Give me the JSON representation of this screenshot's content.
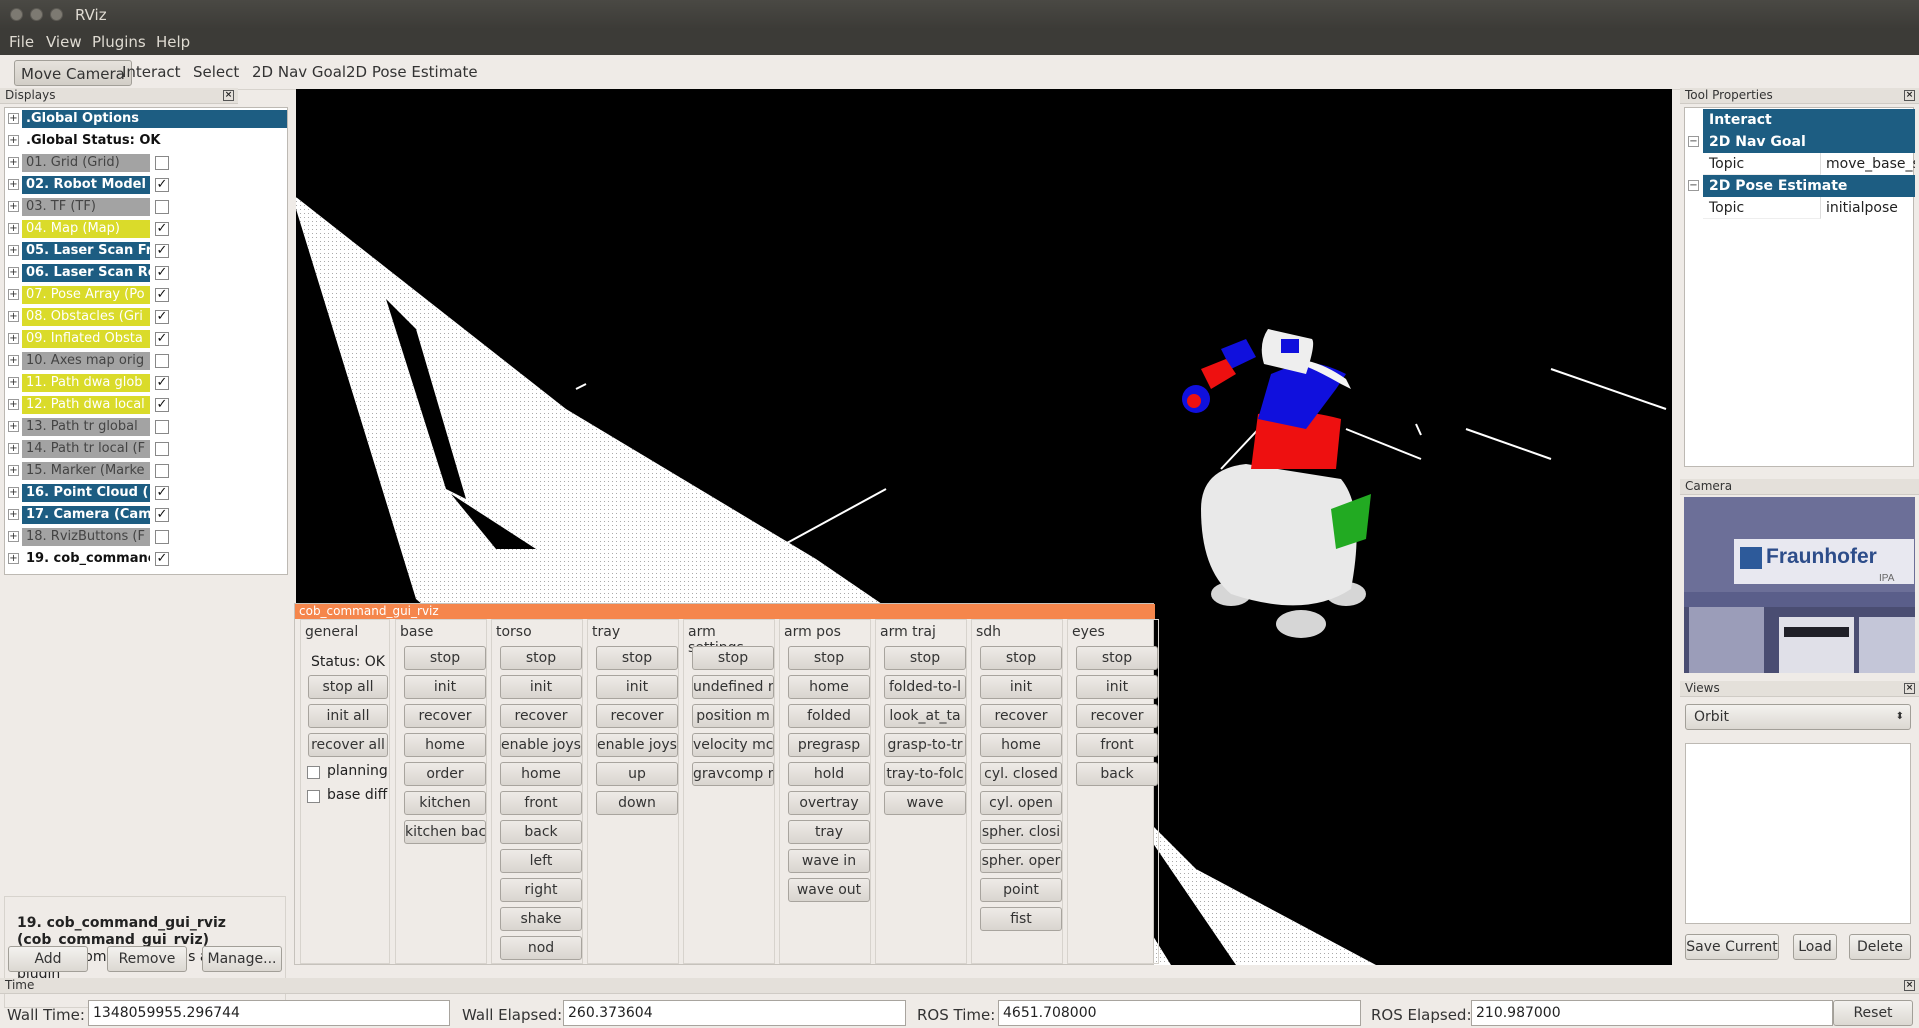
{
  "window": {
    "title": "RViz"
  },
  "menu": [
    "File",
    "View",
    "Plugins",
    "Help"
  ],
  "toolbar": {
    "tools": [
      "Move Camera",
      "Interact",
      "Select",
      "2D Nav Goal",
      "2D Pose Estimate"
    ],
    "active": "Move Camera"
  },
  "displays": {
    "header": "Displays",
    "items": [
      {
        "label": ".Global Options",
        "style": "blue",
        "checked": null
      },
      {
        "label": ".Global Status: OK",
        "style": "white",
        "checked": null
      },
      {
        "label": "01. Grid (Grid)",
        "style": "gray",
        "checked": false
      },
      {
        "label": "02. Robot Model",
        "style": "blue",
        "checked": true
      },
      {
        "label": "03. TF (TF)",
        "style": "gray",
        "checked": false
      },
      {
        "label": "04. Map (Map)",
        "style": "yellow",
        "checked": true
      },
      {
        "label": "05. Laser Scan Fr",
        "style": "blue",
        "checked": true
      },
      {
        "label": "06. Laser Scan Re",
        "style": "blue",
        "checked": true
      },
      {
        "label": "07. Pose Array (Po",
        "style": "yellow",
        "checked": true
      },
      {
        "label": "08. Obstacles (Gri",
        "style": "yellow",
        "checked": true
      },
      {
        "label": "09. Inflated Obsta",
        "style": "yellow",
        "checked": true
      },
      {
        "label": "10. Axes map orig",
        "style": "gray",
        "checked": false
      },
      {
        "label": "11. Path dwa glob",
        "style": "yellow",
        "checked": true
      },
      {
        "label": "12. Path dwa local",
        "style": "yellow",
        "checked": true
      },
      {
        "label": "13. Path tr global",
        "style": "gray",
        "checked": false
      },
      {
        "label": "14. Path tr local (F",
        "style": "gray",
        "checked": false
      },
      {
        "label": "15. Marker (Marke",
        "style": "gray",
        "checked": false
      },
      {
        "label": "16. Point Cloud (",
        "style": "blue",
        "checked": true
      },
      {
        "label": "17. Camera (Cam",
        "style": "blue",
        "checked": true
      },
      {
        "label": "18. RvizButtons (F",
        "style": "gray",
        "checked": false
      },
      {
        "label": "19. cob_commanc",
        "style": "white",
        "checked": true
      }
    ],
    "description": {
      "title": "19. cob_command_gui_rviz (cob_command_gui_rviz)",
      "text": "the cob_command_gui as a rviz plugin"
    },
    "buttons": {
      "add": "Add",
      "remove": "Remove",
      "manage": "Manage..."
    }
  },
  "cob_gui": {
    "title": "cob_command_gui_rviz",
    "general": {
      "title": "general",
      "status": "Status: OK",
      "buttons": [
        "stop all",
        "init all",
        "recover all"
      ],
      "checks": [
        "planning",
        "base diff"
      ]
    },
    "groups": [
      {
        "title": "base",
        "buttons": [
          "stop",
          "init",
          "recover",
          "home",
          "order",
          "kitchen",
          "kitchen bac"
        ]
      },
      {
        "title": "torso",
        "buttons": [
          "stop",
          "init",
          "recover",
          "enable joys",
          "home",
          "front",
          "back",
          "left",
          "right",
          "shake",
          "nod"
        ]
      },
      {
        "title": "tray",
        "buttons": [
          "stop",
          "init",
          "recover",
          "enable joys",
          "up",
          "down"
        ]
      },
      {
        "title": "arm settings",
        "buttons": [
          "stop",
          "undefined r",
          "position m",
          "velocity mc",
          "gravcomp r"
        ]
      },
      {
        "title": "arm pos",
        "buttons": [
          "stop",
          "home",
          "folded",
          "pregrasp",
          "hold",
          "overtray",
          "tray",
          "wave in",
          "wave out"
        ]
      },
      {
        "title": "arm traj",
        "buttons": [
          "stop",
          "folded-to-l",
          "look_at_ta",
          "grasp-to-tr",
          "tray-to-folc",
          "wave"
        ]
      },
      {
        "title": "sdh",
        "buttons": [
          "stop",
          "init",
          "recover",
          "home",
          "cyl. closed",
          "cyl. open",
          "spher. closi",
          "spher. oper",
          "point",
          "fist"
        ]
      },
      {
        "title": "eyes",
        "buttons": [
          "stop",
          "init",
          "recover",
          "front",
          "back"
        ]
      }
    ]
  },
  "tool_properties": {
    "header": "Tool Properties",
    "rows": [
      {
        "label": "Interact",
        "kind": "section"
      },
      {
        "label": "2D Nav Goal",
        "kind": "section-exp"
      },
      {
        "label": "Topic",
        "value": "move_base_simp",
        "kind": "prop"
      },
      {
        "label": "2D Pose Estimate",
        "kind": "section-exp"
      },
      {
        "label": "Topic",
        "value": "initialpose",
        "kind": "prop"
      }
    ]
  },
  "camera": {
    "header": "Camera",
    "sign_text": "Fraunhofer",
    "sign_sub": "IPA"
  },
  "views": {
    "header": "Views",
    "selected": "Orbit",
    "buttons": {
      "save": "Save Current",
      "load": "Load",
      "delete": "Delete"
    }
  },
  "time": {
    "header": "Time",
    "wall_time_label": "Wall Time:",
    "wall_time": "1348059955.296744",
    "wall_elapsed_label": "Wall Elapsed:",
    "wall_elapsed": "260.373604",
    "ros_time_label": "ROS Time:",
    "ros_time": "4651.708000",
    "ros_elapsed_label": "ROS Elapsed:",
    "ros_elapsed": "210.987000",
    "reset": "Reset"
  }
}
